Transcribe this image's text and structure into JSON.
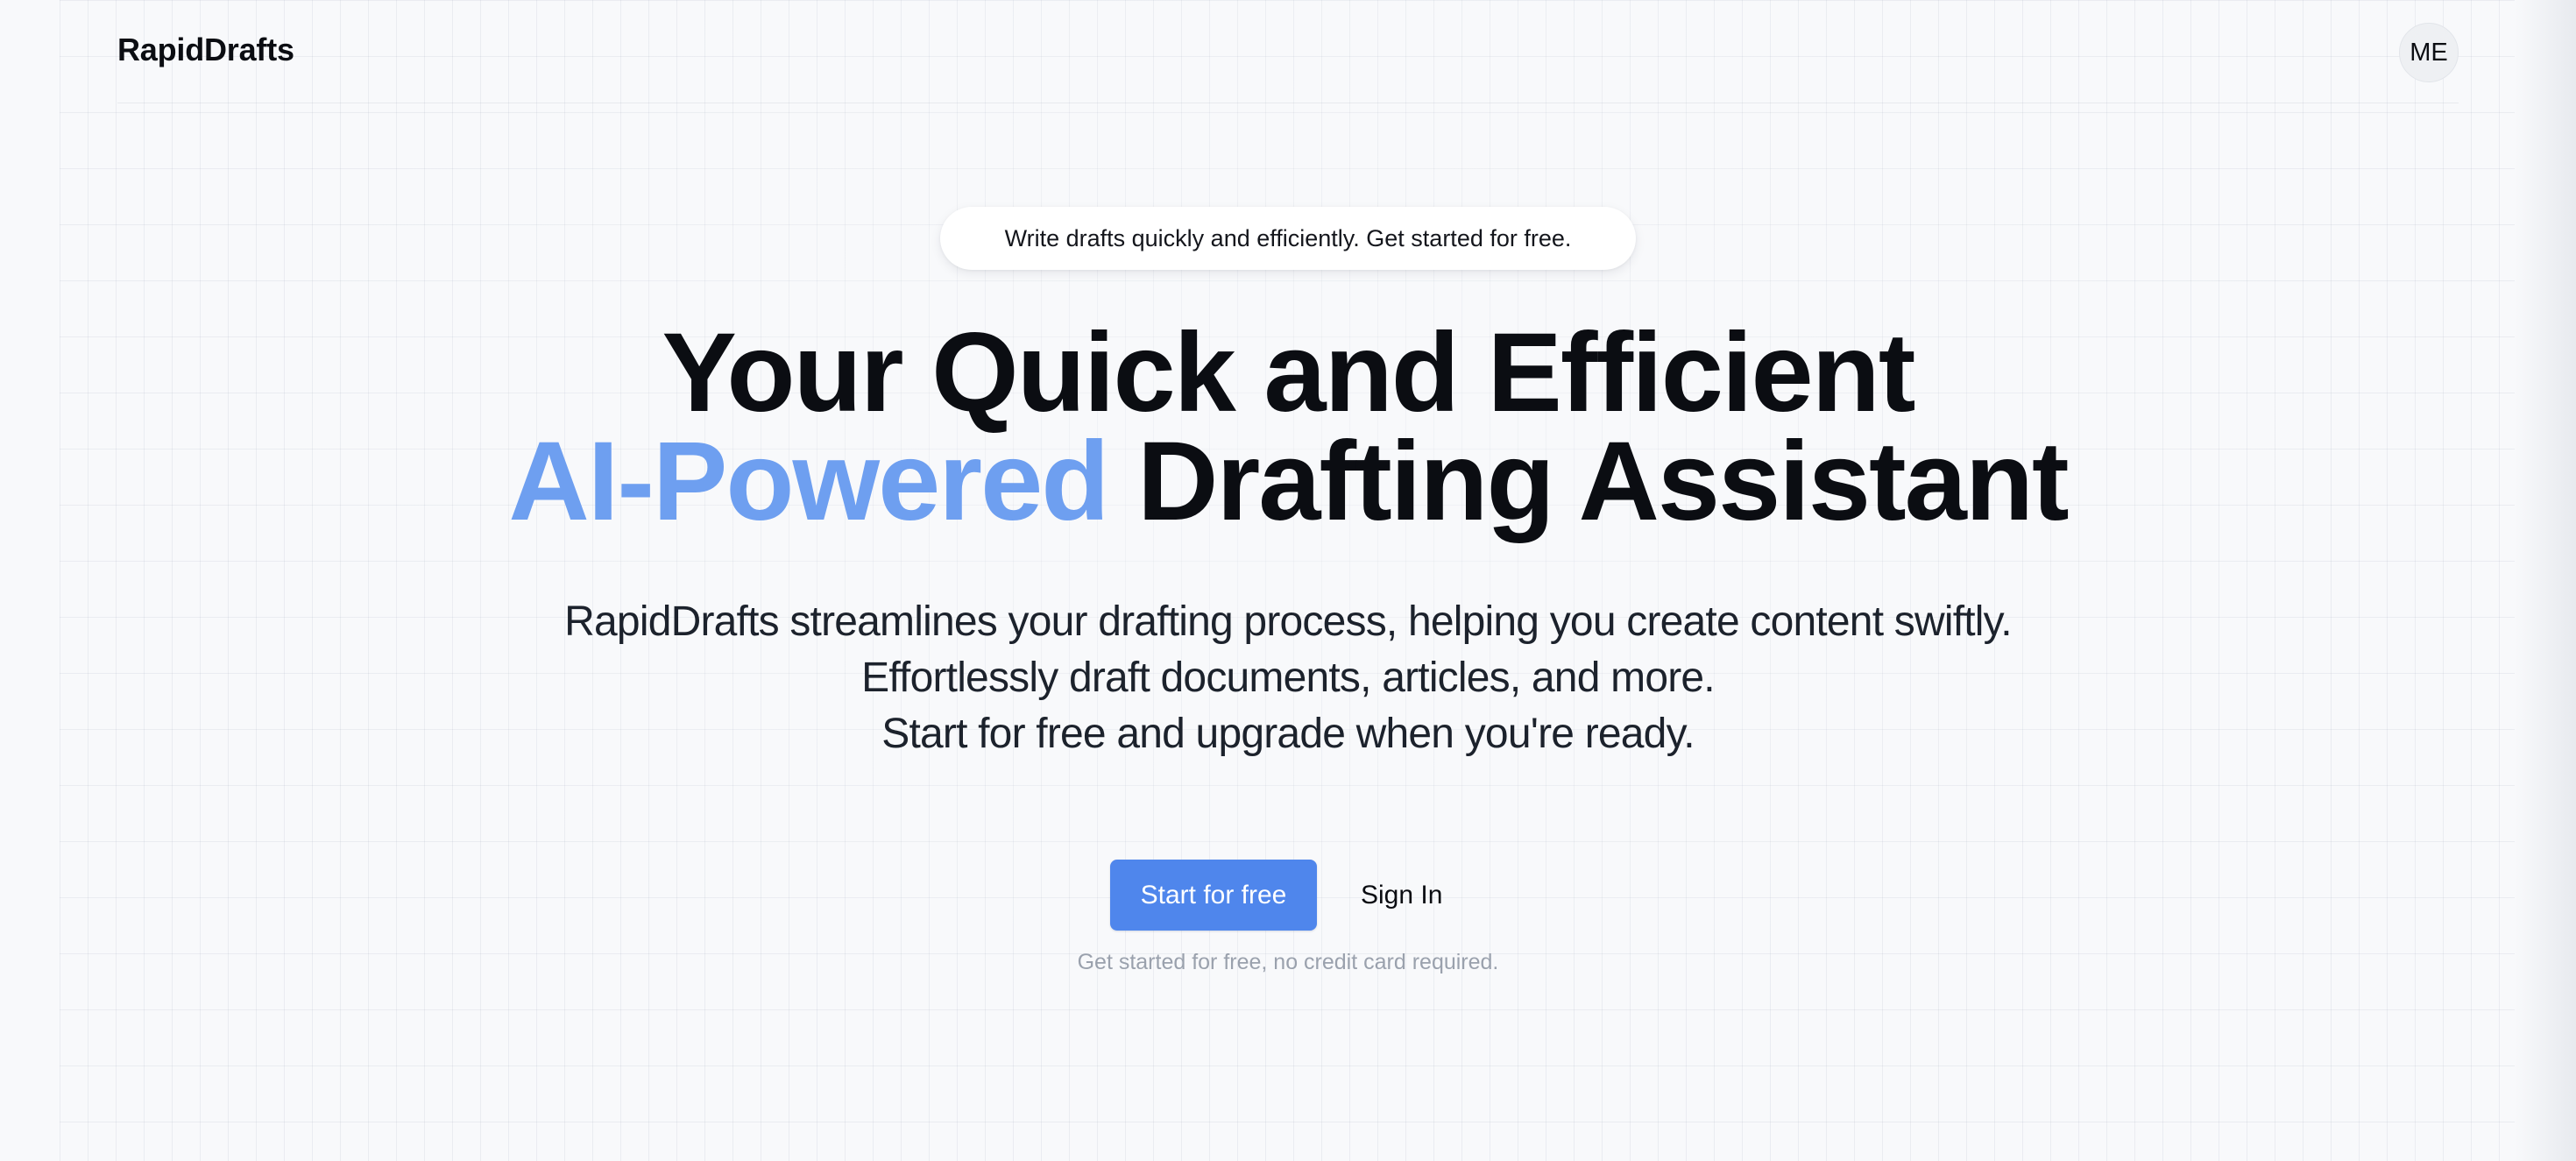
{
  "header": {
    "brand": "RapidDrafts",
    "avatar_initials": "ME"
  },
  "hero": {
    "announcement": "Write drafts quickly and efficiently. Get started for free.",
    "headline_line1": "Your Quick and Efficient",
    "headline_accent": "AI-Powered",
    "headline_line2_rest": " Drafting Assistant",
    "subtext_lines": [
      "RapidDrafts streamlines your drafting process, helping you create content swiftly.",
      "Effortlessly draft documents, articles, and more.",
      "Start for free and upgrade when you're ready."
    ],
    "primary_cta": "Start for free",
    "secondary_cta": "Sign In",
    "note": "Get started for free, no credit card required."
  },
  "colors": {
    "accent": "#6e9ff0",
    "primary_button": "#4f86ec",
    "background": "#f8f9fb"
  }
}
